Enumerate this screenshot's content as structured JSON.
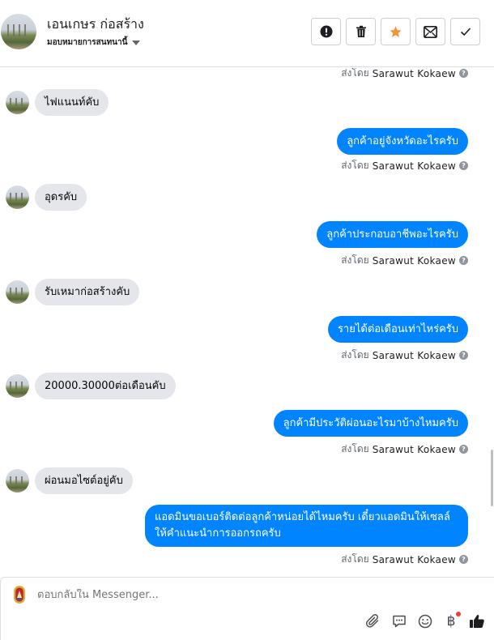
{
  "header": {
    "contact_name": "เอนเกษร ก่อสร้าง",
    "assign_label": "มอบหมายการสนทนานี้",
    "actions": [
      "mark-spam",
      "delete",
      "star",
      "move-to-inbox",
      "mark-done"
    ]
  },
  "sent_by": {
    "prefix": "ส่งโดย",
    "name": "Sarawut Kokaew",
    "info_glyph": "?"
  },
  "messages": [
    {
      "dir": "in",
      "text": "ไฟแนนท์คับ"
    },
    {
      "dir": "out",
      "text": "ลูกค้าอยู่จังหวัดอะไรครับ"
    },
    {
      "dir": "in",
      "text": "อุดรคับ"
    },
    {
      "dir": "out",
      "text": "ลูกค้าประกอบอาชีพอะไรครับ"
    },
    {
      "dir": "in",
      "text": "รับเหมาก่อสร้างคับ"
    },
    {
      "dir": "out",
      "text": "รายได้ต่อเดือนเท่าไหร่ครับ"
    },
    {
      "dir": "in",
      "text": "20000.30000ต่อเดือนคับ"
    },
    {
      "dir": "out",
      "text": "ลูกค้ามีประวัติผ่อนอะไรมาบ้างไหมครับ"
    },
    {
      "dir": "in",
      "text": "ผ่อนมอไซต์อยู่คับ"
    },
    {
      "dir": "out",
      "text": "แอดมินขอเบอร์ติดต่อลูกค้าหน่อยได้ไหมครับ เดี๋ยวแอดมินให้เซลล์ให้คำแนะนำการออกรถครับ"
    }
  ],
  "composer": {
    "placeholder": "ตอบกลับใน Messenger...",
    "currency_glyph": "฿"
  }
}
